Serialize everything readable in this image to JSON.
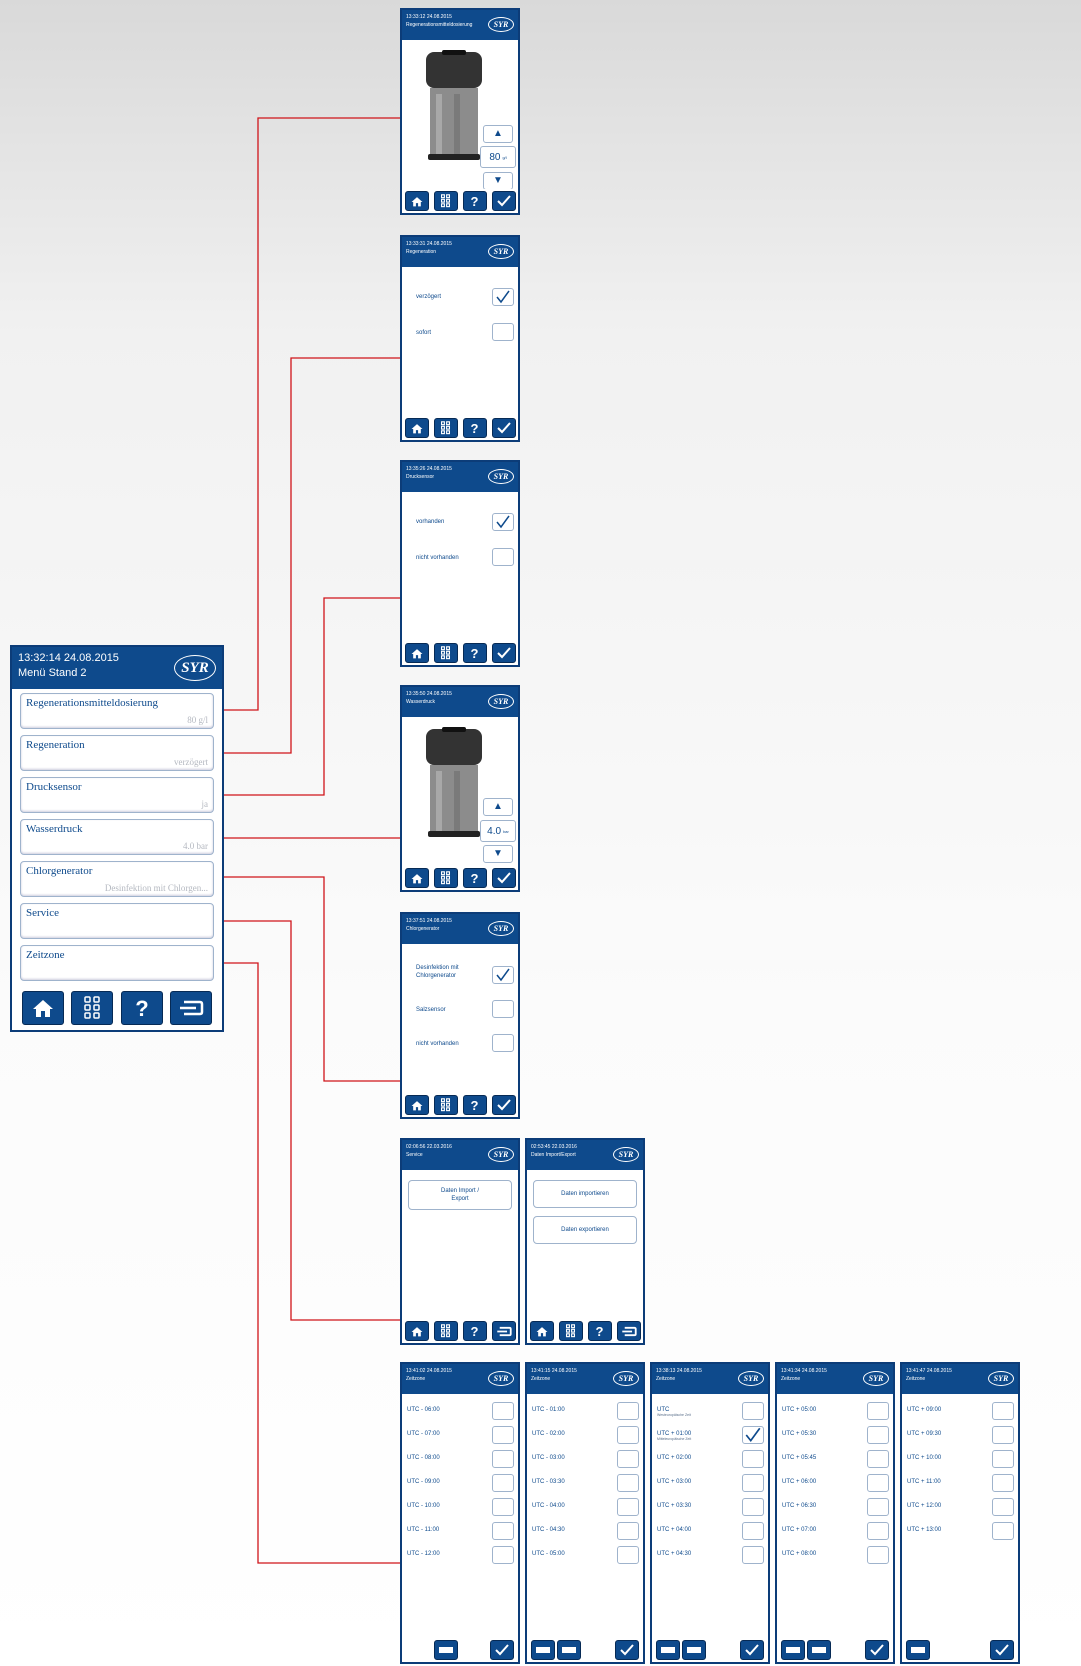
{
  "menu": {
    "time": "13:32:14 24.08.2015",
    "title": "Menü Stand 2",
    "logo": "SYR",
    "items": [
      {
        "label": "Regenerationsmitteldosierung",
        "value": "80 g/l"
      },
      {
        "label": "Regeneration",
        "value": "verzögert"
      },
      {
        "label": "Drucksensor",
        "value": "ja"
      },
      {
        "label": "Wasserdruck",
        "value": "4.0 bar"
      },
      {
        "label": "Chlorgenerator",
        "value": "Desinfektion mit Chlorgen..."
      },
      {
        "label": "Service",
        "value": ""
      },
      {
        "label": "Zeitzone",
        "value": ""
      }
    ],
    "bar_icons": [
      "home-icon",
      "grid-icon",
      "help-icon",
      "back-icon"
    ]
  },
  "screens": {
    "dosierung": {
      "time": "13:33:12 24.08.2015",
      "title": "Regenerationsmitteldosierung",
      "value": "80",
      "unit": "g/l"
    },
    "regeneration": {
      "time": "13:33:31 24.08.2015",
      "title": "Regeneration",
      "options": [
        "verzögert",
        "sofort"
      ],
      "checked": 0
    },
    "drucksensor": {
      "time": "13:35:26 24.08.2015",
      "title": "Drucksensor",
      "options": [
        "vorhanden",
        "nicht vorhanden"
      ],
      "checked": 0
    },
    "wasserdruck": {
      "time": "13:35:50 24.08.2015",
      "title": "Wasserdruck",
      "value": "4.0",
      "unit": "bar"
    },
    "chlorgenerator": {
      "time": "13:37:51 24.08.2015",
      "title": "Chlorgenerator",
      "options": [
        "Desinfektion mit Chlorgenerator",
        "Salzsensor",
        "nicht vorhanden"
      ],
      "checked": 0
    },
    "service": {
      "time": "02:06:56 22.03.2016",
      "title": "Service",
      "button": "Daten Import / Export"
    },
    "import_export": {
      "time": "02:53:45 22.03.2016",
      "title": "Daten Import/Export",
      "buttons": [
        "Daten importieren",
        "Daten exportieren"
      ]
    },
    "zeitzone_title": "Zeitzone",
    "zeitzone_pages": [
      {
        "time": "13:41:02 24.08.2015",
        "items": [
          "UTC - 06:00",
          "UTC - 07:00",
          "UTC - 08:00",
          "UTC - 09:00",
          "UTC - 10:00",
          "UTC - 11:00",
          "UTC - 12:00"
        ]
      },
      {
        "time": "13:41:15 24.08.2015",
        "items": [
          "UTC - 01:00",
          "UTC - 02:00",
          "UTC - 03:00",
          "UTC - 03:30",
          "UTC - 04:00",
          "UTC - 04:30",
          "UTC - 05:00"
        ]
      },
      {
        "time": "13:38:13 24.08.2015",
        "items": [
          "UTC",
          "UTC + 01:00",
          "UTC + 02:00",
          "UTC + 03:00",
          "UTC + 03:30",
          "UTC + 04:00",
          "UTC + 04:30"
        ],
        "checked": 1,
        "subs": [
          "Westeuropäische Zeit",
          "Mitteleuropäische Zeit"
        ]
      },
      {
        "time": "13:41:34 24.08.2015",
        "items": [
          "UTC + 05:00",
          "UTC + 05:30",
          "UTC + 05:45",
          "UTC + 06:00",
          "UTC + 06:30",
          "UTC + 07:00",
          "UTC + 08:00"
        ]
      },
      {
        "time": "13:41:47 24.08.2015",
        "items": [
          "UTC + 09:00",
          "UTC + 09:30",
          "UTC + 10:00",
          "UTC + 11:00",
          "UTC + 12:00",
          "UTC + 13:00"
        ]
      }
    ]
  },
  "colors": {
    "accent": "#0e4a8c",
    "arrow": "#d0141a"
  }
}
